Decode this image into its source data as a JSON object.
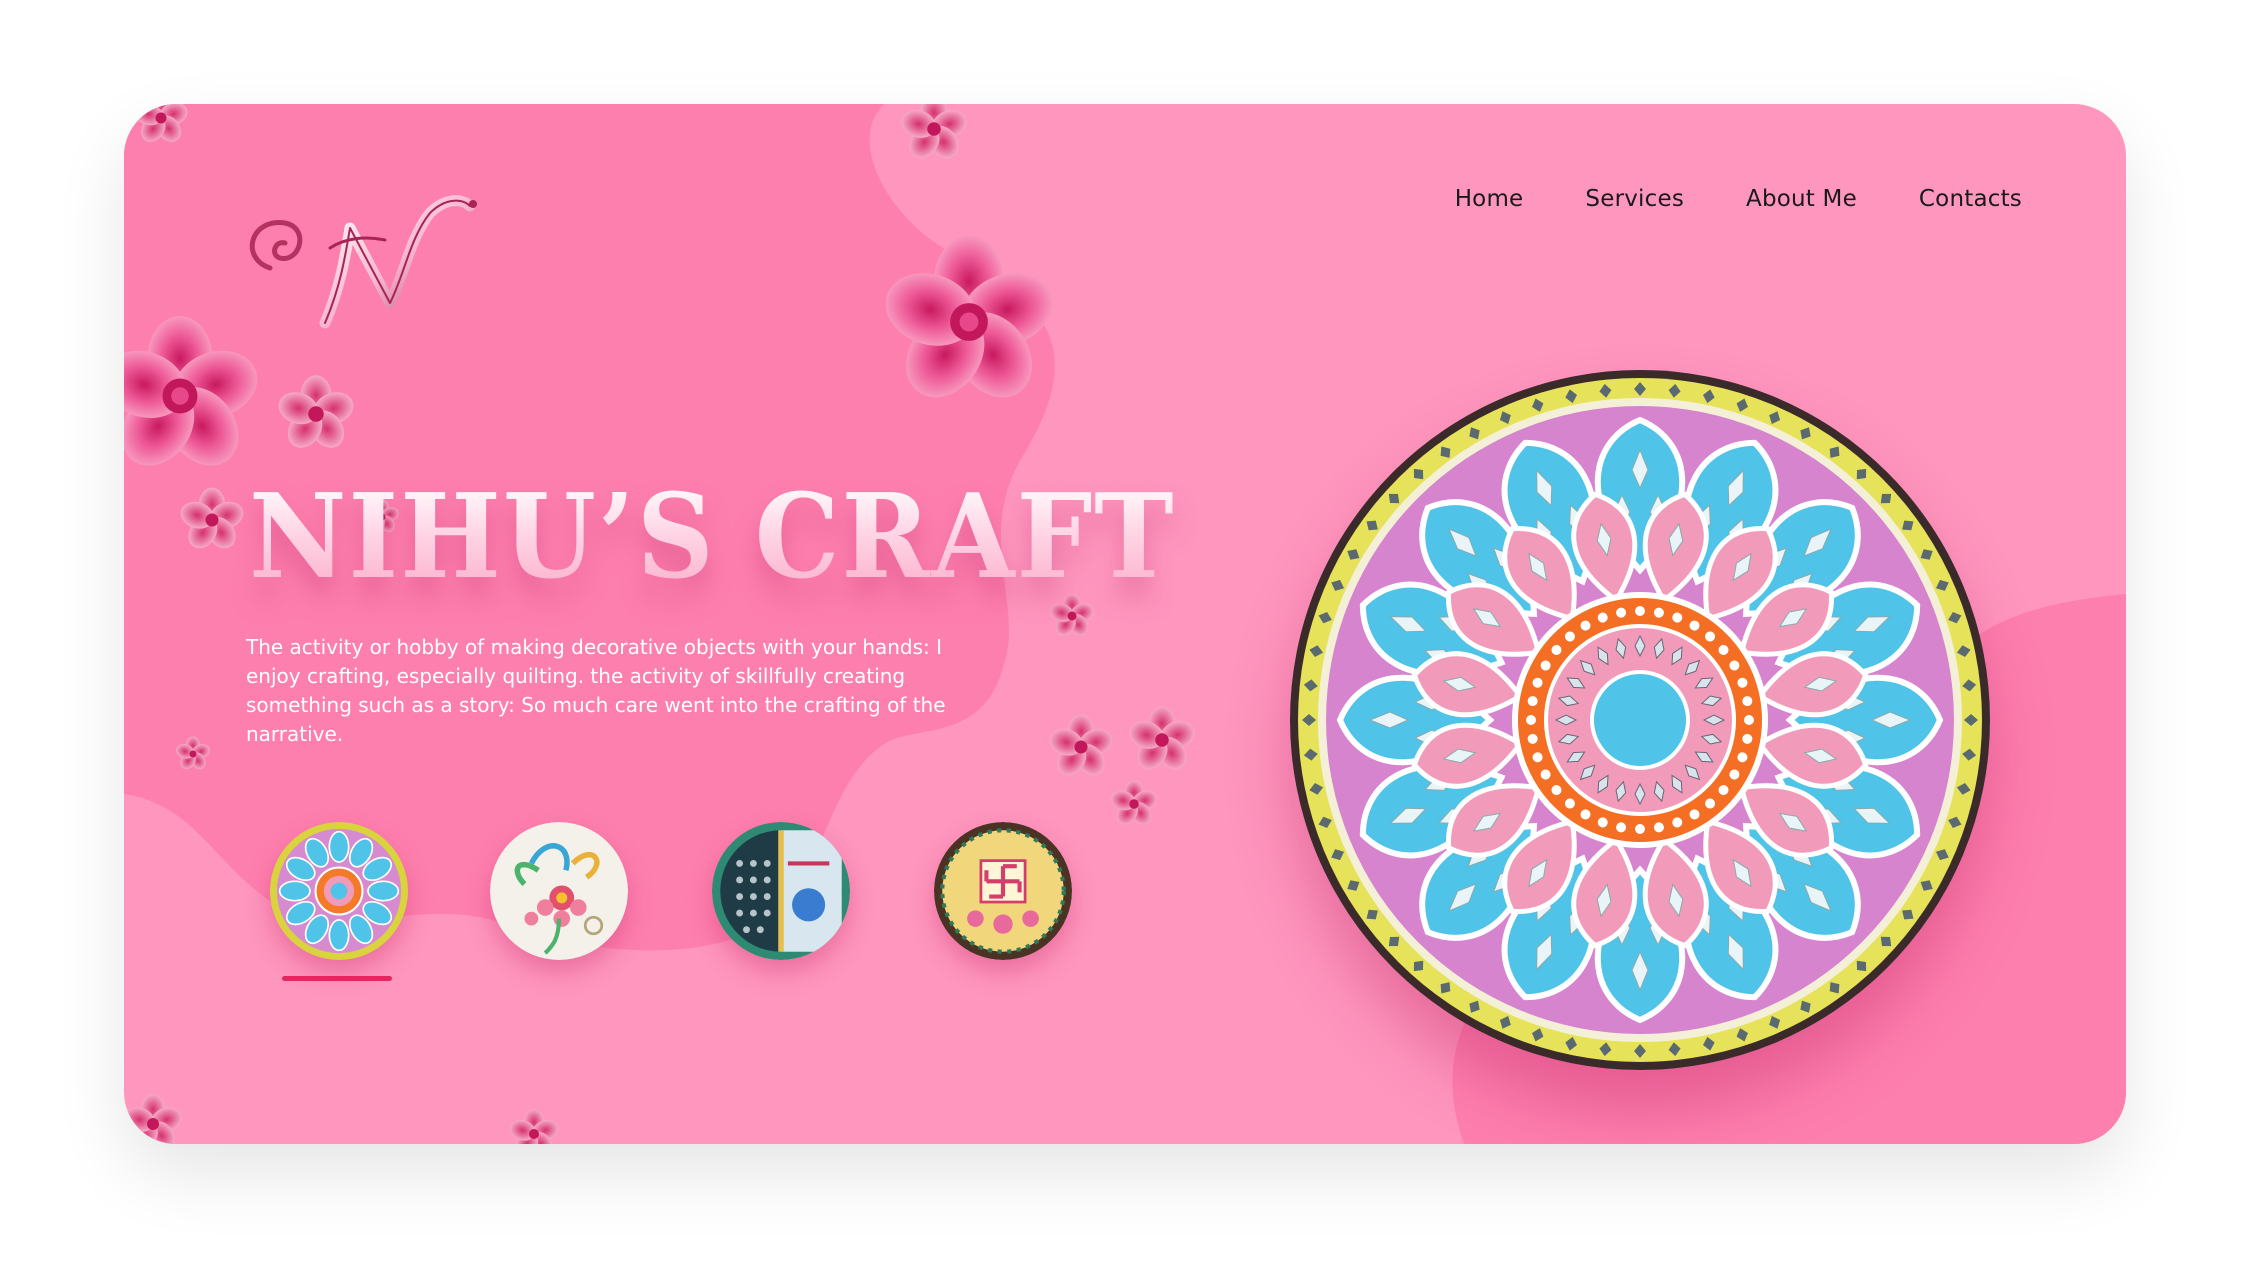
{
  "brand": {
    "logo_icon": "n-monogram-logo"
  },
  "nav": {
    "items": [
      {
        "label": "Home"
      },
      {
        "label": "Services"
      },
      {
        "label": "About Me"
      },
      {
        "label": "Contacts"
      }
    ]
  },
  "hero": {
    "title": "NIHU’S CRAFT",
    "description": "The activity or hobby of making decorative objects with your hands: I enjoy crafting, especially quilting. the activity of skillfully creating something such as a story: So much care went into the crafting of the narrative."
  },
  "gallery": {
    "selected_index": 0,
    "thumbnails": [
      {
        "icon": "mandala-plate-thumbnail"
      },
      {
        "icon": "quilling-flower-thumbnail"
      },
      {
        "icon": "mirror-art-thumbnail"
      },
      {
        "icon": "swastik-plate-thumbnail"
      }
    ],
    "featured_icon": "lippan-mandala-plate"
  },
  "colors": {
    "card_background": "#fe96be",
    "blob_background": "#fd7fae",
    "accent": "#e2285f",
    "nav_text": "#1a1a1a",
    "flower": "#e8488a"
  }
}
